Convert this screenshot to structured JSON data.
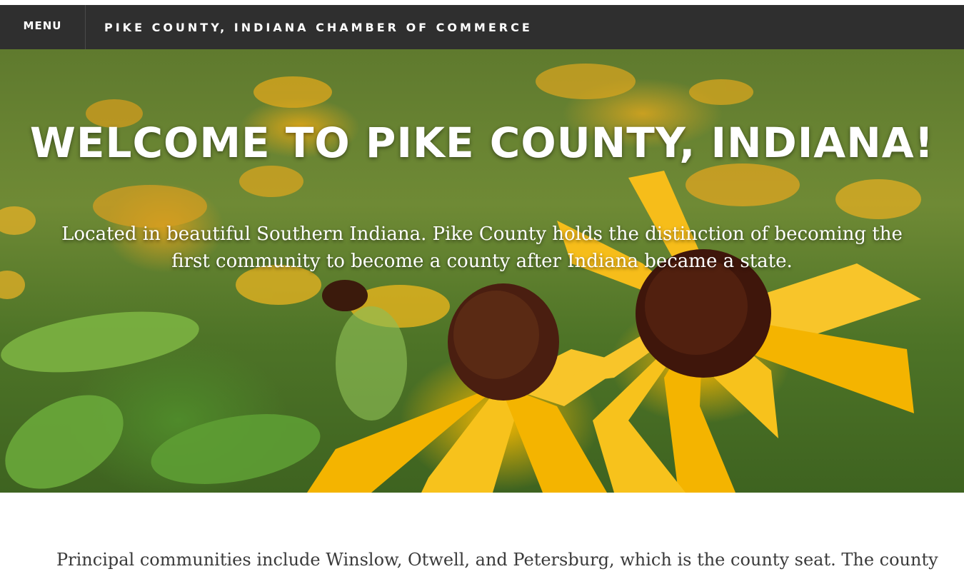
{
  "nav": {
    "menu_label": "MENU",
    "site_title": "PIKE COUNTY, INDIANA CHAMBER OF COMMERCE"
  },
  "hero": {
    "title": "WELCOME TO PIKE COUNTY, INDIANA!",
    "text": "Located in beautiful Southern Indiana. Pike County holds the distinction of becoming the first community to become a county after Indiana became a state.",
    "image": "black-eyed-susan-flowers-photo"
  },
  "main": {
    "intro": "Principal communities include Winslow, Otwell, and Petersburg, which is the county seat.   The county"
  },
  "colors": {
    "navbar": "#2f2f2f",
    "text_dark": "#3a3a3a",
    "hero_text": "#ffffff"
  }
}
